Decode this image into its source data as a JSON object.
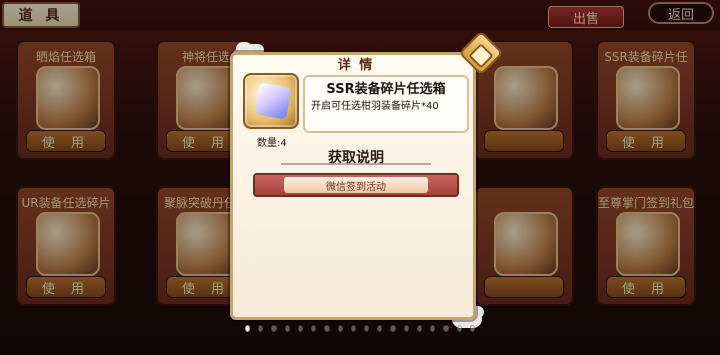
{
  "header": {
    "title": "道 具",
    "sell_tab": "出售",
    "back": "返回"
  },
  "cards": [
    {
      "title": "晒焰任选箱",
      "button": "使 用"
    },
    {
      "title": "神将任选",
      "button": "使 用"
    },
    {
      "title": "",
      "button": ""
    },
    {
      "title": "",
      "button": ""
    },
    {
      "title": "SSR装备碎片任",
      "button": "使 用"
    },
    {
      "title": "UR装备任选碎片箱",
      "button": "使 用"
    },
    {
      "title": "聚脉突破丹任选",
      "button": "使 用"
    },
    {
      "title": "",
      "button": ""
    },
    {
      "title": "",
      "button": ""
    },
    {
      "title": "至尊掌门签到礼包",
      "button": "使 用"
    }
  ],
  "modal": {
    "header": "详 情",
    "item_name": "SSR装备碎片任选箱",
    "item_desc": "开启可任选柑羽装备碎片*40",
    "quantity_label": "数量:4",
    "section_title": "获取说明",
    "source": "微信签到活动"
  },
  "pager": {
    "total": 18,
    "active_index": 0
  }
}
